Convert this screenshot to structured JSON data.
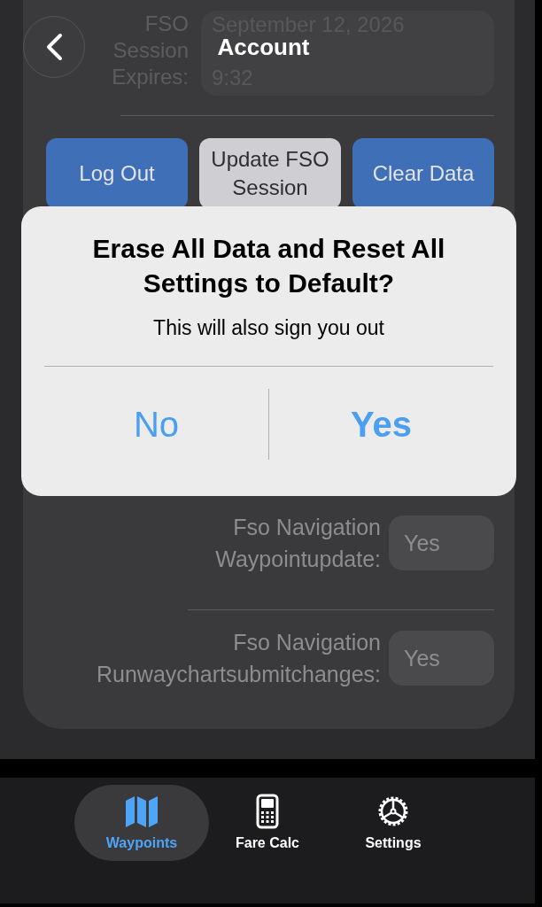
{
  "header": {
    "title": "Account"
  },
  "session": {
    "label": "FSO Session Expires:",
    "value": "September 12, 2026 9:32"
  },
  "buttons": [
    {
      "label": "Log Out",
      "kind": "primary"
    },
    {
      "label": "Update FSO Session",
      "kind": "secondary"
    },
    {
      "label": "Clear Data",
      "kind": "primary"
    }
  ],
  "settings": [
    {
      "label": "Fso Navigation\nWaypointupdate:",
      "value": "Yes"
    },
    {
      "label": "Fso Navigation\nRunwaychartsubmitchanges:",
      "value": "Yes"
    }
  ],
  "dialog": {
    "title": "Erase All Data and Reset All Settings to Default?",
    "message": "This will also sign you out",
    "actions": [
      {
        "label": "No",
        "kind": "cancel"
      },
      {
        "label": "Yes",
        "kind": "default"
      }
    ]
  },
  "tabs": [
    {
      "label": "Waypoints",
      "selected": true
    },
    {
      "label": "Fare Calc",
      "selected": false
    },
    {
      "label": "Settings",
      "selected": false
    }
  ]
}
